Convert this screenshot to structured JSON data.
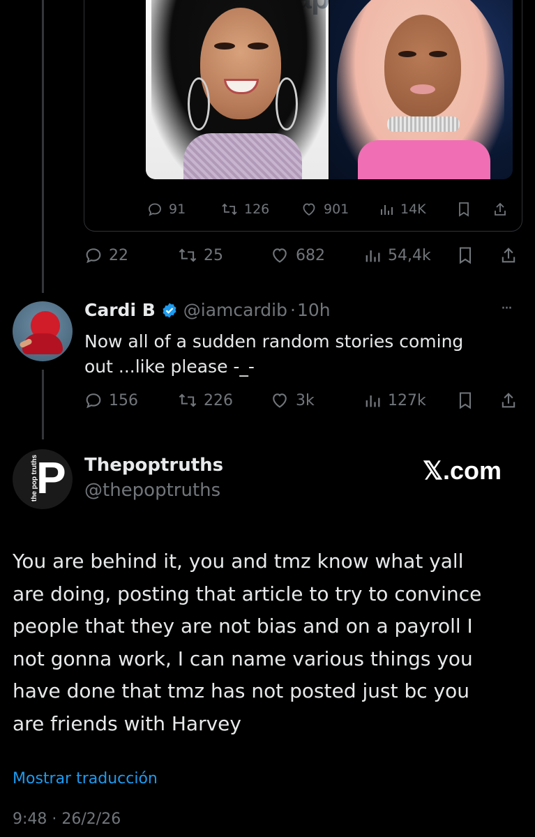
{
  "quoted_card": {
    "image_watermark": "cap",
    "stats": {
      "replies": "91",
      "retweets": "126",
      "likes": "901",
      "views": "14K"
    }
  },
  "parent_tweet": {
    "stats": {
      "replies": "22",
      "retweets": "25",
      "likes": "682",
      "views": "54,4k"
    }
  },
  "cardi_tweet": {
    "name": "Cardi B",
    "handle": "@iamcardib",
    "separator": "·",
    "time": "10h",
    "more": "···",
    "text_line1": "Now all of a sudden random stories coming",
    "text_line2": "out ...like please -_-",
    "stats": {
      "replies": "156",
      "retweets": "226",
      "likes": "3k",
      "views": "127k"
    }
  },
  "main_tweet": {
    "avatar_letter": "P",
    "avatar_vertical_text": "the pop truths",
    "name": "Thepoptruths",
    "handle": "@thepoptruths",
    "brand": "𝕏.com",
    "text_lines": [
      "You are behind it, you and tmz know what yall",
      "are doing, posting that article to try to convince",
      "people that they are not bias and on a payroll I",
      "not gonna work, I can name various things you",
      "have done that tmz has not posted just bc you",
      "are friends with Harvey"
    ],
    "translate_link": "Mostrar traducción",
    "timestamp": "9:48 · 26/2/26"
  },
  "colors": {
    "background": "#000000",
    "text": "#e7e9ea",
    "muted": "#71767b",
    "link": "#1d9bf0",
    "verified": "#1d9bf0"
  }
}
